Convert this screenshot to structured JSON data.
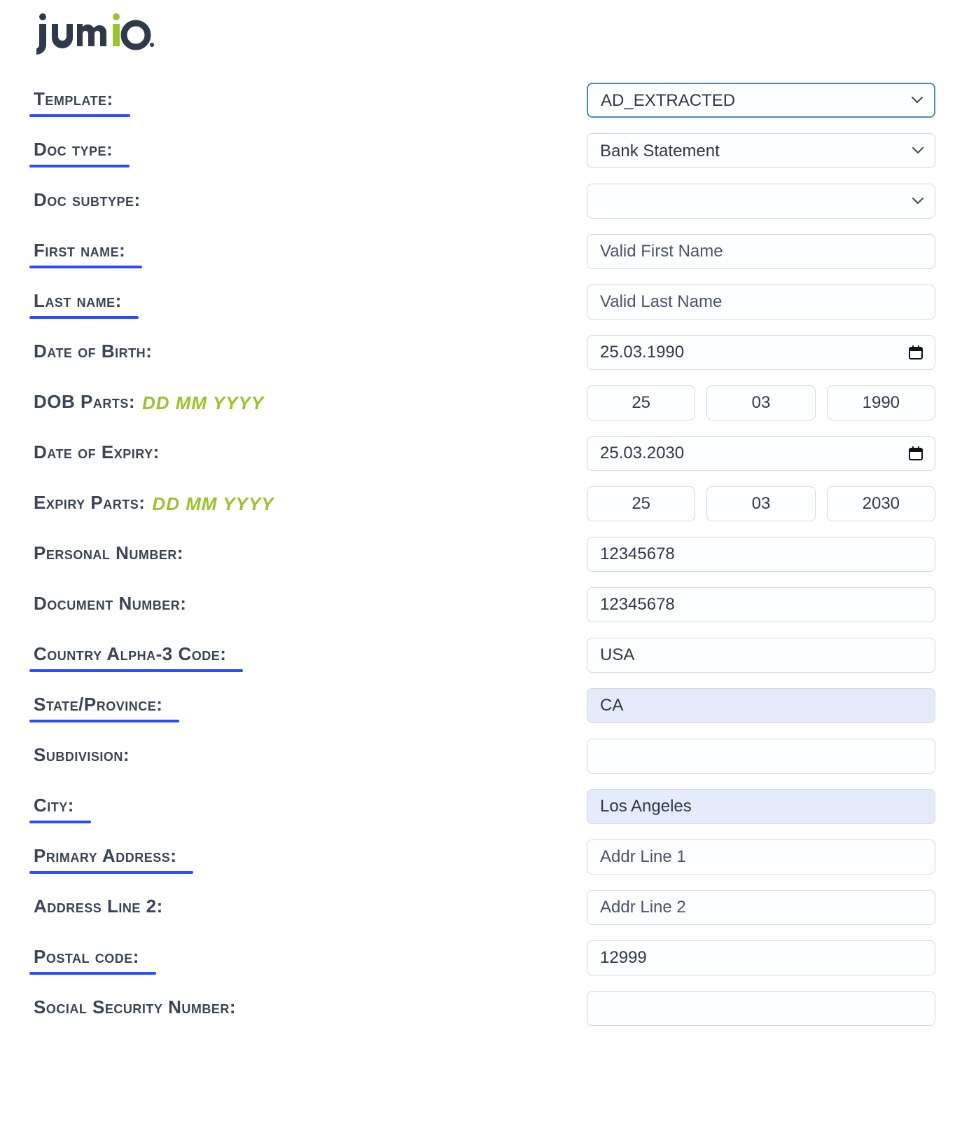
{
  "logo": {
    "brand": "jumio"
  },
  "labels": {
    "template": "Template:",
    "doc_type": "Doc type:",
    "doc_subtype": "Doc subtype:",
    "first_name": "First name:",
    "last_name": "Last name:",
    "date_of_birth": "Date of Birth:",
    "dob_parts": "DOB Parts:",
    "date_of_expiry": "Date of Expiry:",
    "expiry_parts": "Expiry Parts:",
    "personal_number": "Personal Number:",
    "document_number": "Document Number:",
    "country_alpha3": "Country Alpha-3 Code:",
    "state_province": "State/Province:",
    "subdivision": "Subdivision:",
    "city": "City:",
    "primary_address": "Primary Address:",
    "address_line_2": "Address Line 2:",
    "postal_code": "Postal code:",
    "ssn": "Social Security Number:"
  },
  "hints": {
    "dd_mm_yyyy": "DD MM YYYY"
  },
  "placeholders": {
    "first_name": "Valid First Name",
    "last_name": "Valid Last Name",
    "addr1": "Addr Line 1",
    "addr2": "Addr Line 2"
  },
  "values": {
    "template": "AD_EXTRACTED",
    "doc_type": "Bank Statement",
    "doc_subtype": "",
    "first_name": "",
    "last_name": "",
    "dob": "25.03.1990",
    "dob_dd": "25",
    "dob_mm": "03",
    "dob_yyyy": "1990",
    "expiry": "25.03.2030",
    "expiry_dd": "25",
    "expiry_mm": "03",
    "expiry_yyyy": "2030",
    "personal_number": "12345678",
    "document_number": "12345678",
    "country_alpha3": "USA",
    "state_province": "CA",
    "subdivision": "",
    "city": "Los Angeles",
    "primary_address": "",
    "address_line_2": "",
    "postal_code": "12999",
    "ssn": ""
  }
}
